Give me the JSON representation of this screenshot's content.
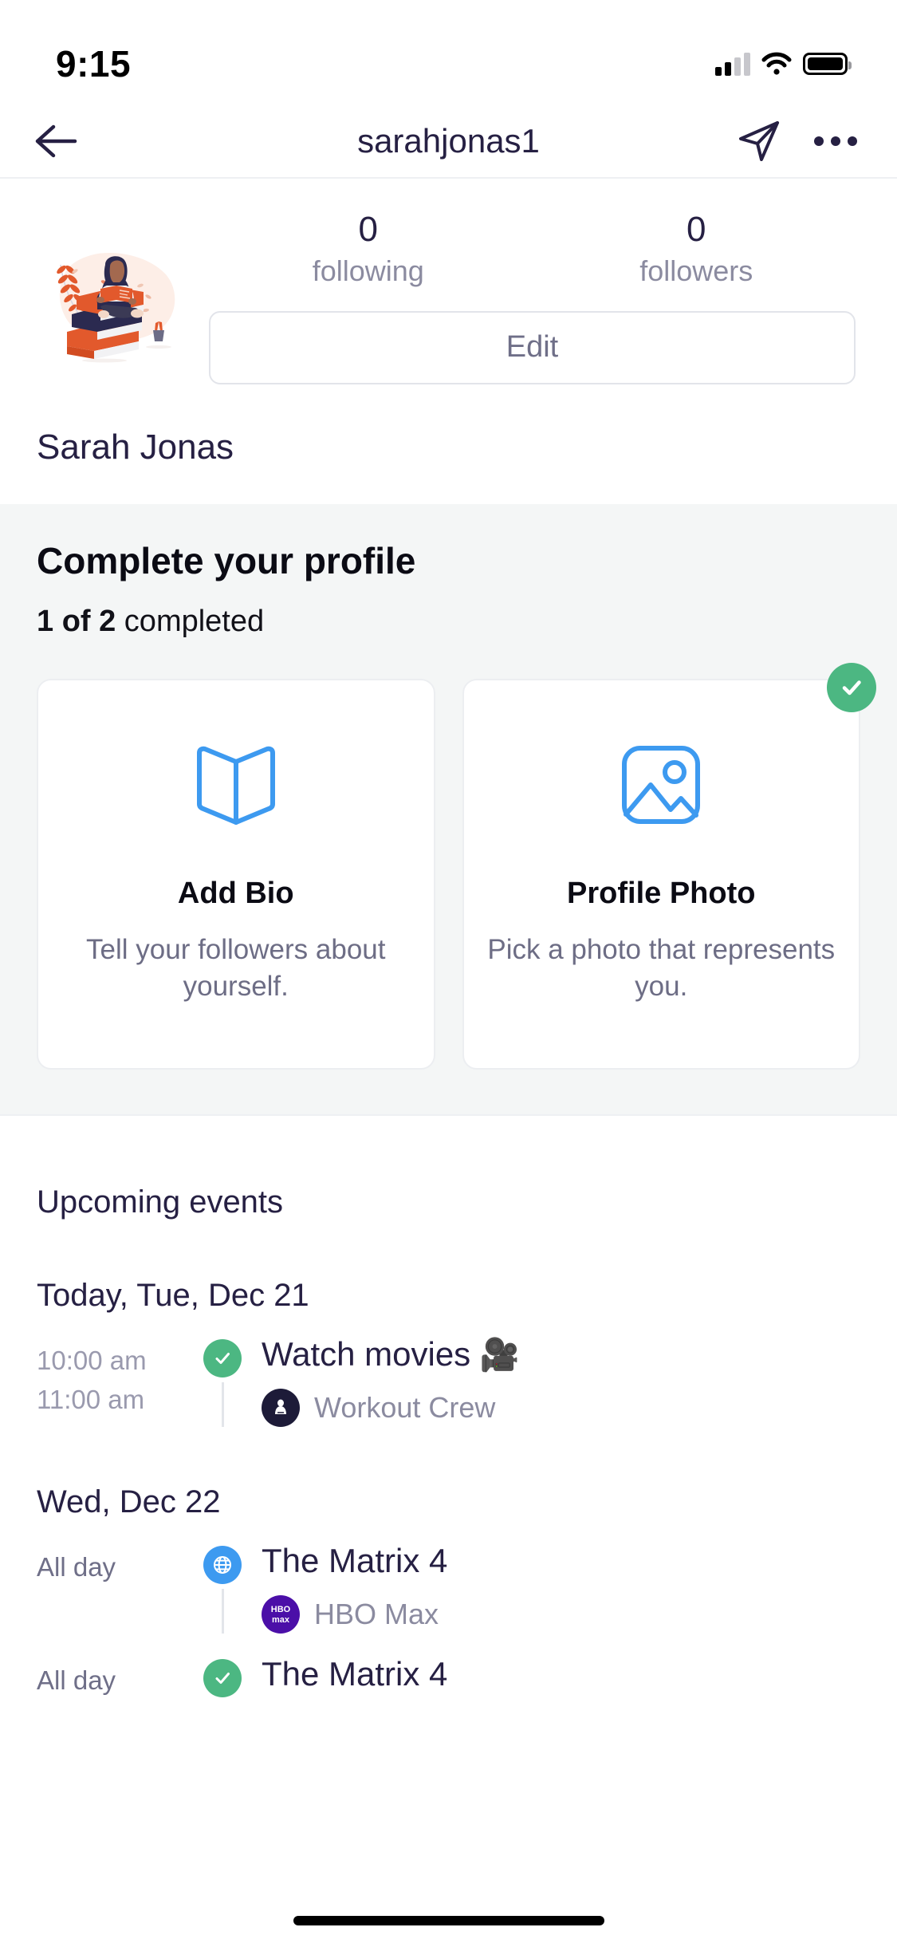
{
  "status_bar": {
    "time": "9:15",
    "signal_icon": "cellular-signal-icon",
    "wifi_icon": "wifi-icon",
    "battery_icon": "battery-icon",
    "signal_bars_filled": 2,
    "signal_bars_total": 4
  },
  "nav": {
    "back_icon": "back-arrow-icon",
    "title": "sarahjonas1",
    "send_icon": "send-paper-plane-icon",
    "more_icon": "more-options-icon"
  },
  "profile": {
    "avatar_icon": "reading-woman-illustration-avatar",
    "full_name": "Sarah Jonas",
    "stats": [
      {
        "value": "0",
        "label": "following"
      },
      {
        "value": "0",
        "label": "followers"
      }
    ],
    "edit_label": "Edit"
  },
  "complete_profile": {
    "title": "Complete your profile",
    "progress_bold": "1 of 2",
    "progress_rest": " completed",
    "cards": [
      {
        "icon": "open-book-icon",
        "title": "Add Bio",
        "description": "Tell your followers about yourself.",
        "completed": false
      },
      {
        "icon": "image-photo-icon",
        "title": "Profile Photo",
        "description": "Pick a photo that represents you.",
        "completed": true,
        "badge_icon": "check-circle-icon"
      }
    ]
  },
  "events": {
    "title": "Upcoming events",
    "days": [
      {
        "heading": "Today, Tue, Dec 21",
        "items": [
          {
            "start_time": "10:00 am",
            "end_time": "11:00 am",
            "marker_icon": "check-circle-icon",
            "marker_color": "#4cb782",
            "name": "Watch movies",
            "emoji": "🎥",
            "source_avatar_icon": "workout-crew-group-avatar",
            "source_name": "Workout Crew"
          }
        ]
      },
      {
        "heading": "Wed, Dec 22",
        "items": [
          {
            "start_time": "All day",
            "end_time": "",
            "marker_icon": "globe-icon",
            "marker_color": "#3d9af0",
            "name": "The Matrix 4",
            "emoji": "",
            "source_avatar_icon": "hbo-max-logo-icon",
            "source_name": "HBO Max"
          },
          {
            "start_time": "All day",
            "end_time": "",
            "marker_icon": "check-circle-icon",
            "marker_color": "#4cb782",
            "name": "The Matrix 4",
            "emoji": "",
            "source_avatar_icon": "",
            "source_name": ""
          }
        ]
      }
    ]
  },
  "colors": {
    "accent_blue": "#3d9af0",
    "success_green": "#4cb782",
    "text_navy": "#262043",
    "muted_gray": "#8b8ba0",
    "panel_gray": "#f4f6f6"
  }
}
